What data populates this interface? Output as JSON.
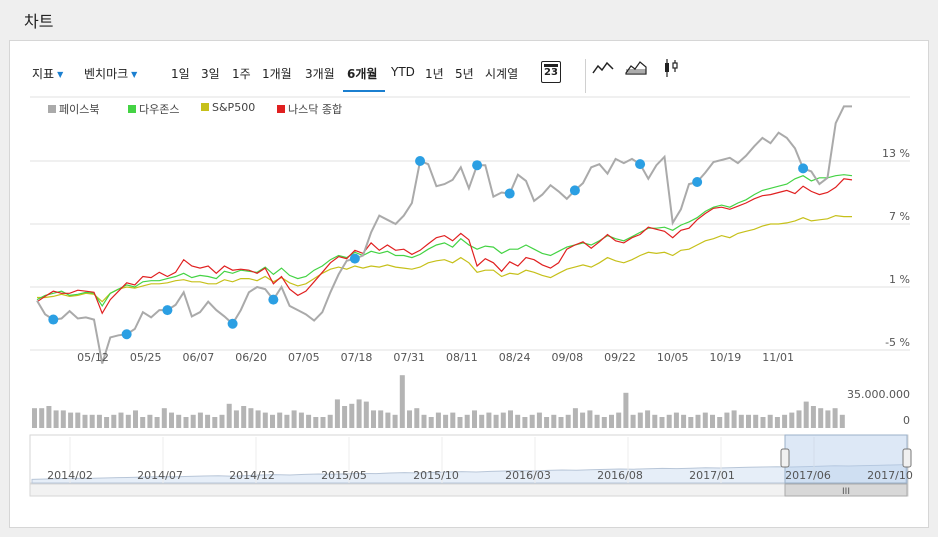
{
  "header": {
    "title": "차트"
  },
  "toolbar": {
    "indicator_label": "지표",
    "benchmark_label": "벤치마크",
    "periods": [
      "1일",
      "3일",
      "1주",
      "1개월",
      "3개월",
      "6개월",
      "YTD",
      "1년",
      "5년",
      "시계열"
    ],
    "active_period": "6개월",
    "calendar_label": "23"
  },
  "legend": [
    {
      "name": "페이스북",
      "color": "#aaaaaa"
    },
    {
      "name": "다우존스",
      "color": "#44d344"
    },
    {
      "name": "S&P500",
      "color": "#c6c01a"
    },
    {
      "name": "나스닥 종합",
      "color": "#e02020"
    }
  ],
  "volume_axis": {
    "max_label": "35.000.000",
    "min_label": "0"
  },
  "navigator": {
    "labels": [
      "2014/02",
      "2014/07",
      "2014/12",
      "2015/05",
      "2015/10",
      "2016/03",
      "2016/08",
      "2017/01",
      "2017/06",
      "2017/10"
    ]
  },
  "chart_data": {
    "type": "line",
    "y_unit": "%",
    "yticks": [
      "13 %",
      "7 %",
      "1 %",
      "-5 %"
    ],
    "xticks": [
      "05/12",
      "05/25",
      "06/07",
      "06/20",
      "07/05",
      "07/18",
      "07/31",
      "08/11",
      "08/24",
      "09/08",
      "09/22",
      "10/05",
      "10/19",
      "11/01"
    ],
    "ylim": [
      -5,
      19
    ],
    "series": [
      {
        "name": "페이스북",
        "color": "#aaaaaa",
        "values": [
          -0.3,
          -1.6,
          -2.1,
          -2.0,
          -1.3,
          -2.0,
          -1.9,
          -2.1,
          -6.3,
          -3.8,
          -3.6,
          -3.5,
          -3.0,
          -1.4,
          -1.9,
          -1.2,
          -1.2,
          -0.7,
          0.5,
          -1.8,
          -1.4,
          -0.4,
          -1.2,
          -1.8,
          -2.5,
          -1.2,
          0.5,
          1.0,
          0.8,
          -0.2,
          1.0,
          -0.8,
          -1.2,
          -1.6,
          -2.2,
          -1.4,
          0.5,
          2.2,
          3.5,
          3.7,
          4.0,
          6.2,
          7.8,
          7.4,
          7.0,
          7.8,
          9.0,
          13.0,
          12.7,
          10.6,
          10.8,
          11.2,
          12.4,
          10.4,
          12.6,
          12.6,
          9.6,
          10.0,
          9.9,
          11.7,
          11.1,
          9.2,
          9.8,
          10.7,
          10.1,
          9.4,
          10.2,
          10.9,
          12.4,
          12.7,
          11.8,
          13.2,
          12.8,
          13.2,
          12.7,
          11.3,
          12.6,
          13.4,
          7.1,
          8.4,
          10.8,
          11.0,
          11.9,
          12.9,
          13.1,
          13.3,
          12.8,
          13.5,
          14.4,
          15.2,
          14.7,
          15.7,
          15.2,
          14.2,
          12.3,
          12.0,
          10.8,
          11.4,
          16.6,
          18.2,
          18.2
        ]
      },
      {
        "name": "다우존스",
        "color": "#44d344",
        "values": [
          -0.2,
          0.2,
          0.4,
          0.6,
          0.2,
          0.3,
          0.5,
          0.4,
          -0.8,
          0.4,
          0.8,
          1.2,
          1.0,
          1.5,
          1.6,
          1.6,
          1.8,
          2.0,
          2.3,
          1.9,
          2.1,
          2.0,
          1.8,
          2.5,
          2.3,
          2.6,
          2.5,
          2.4,
          2.9,
          2.2,
          2.8,
          2.1,
          1.8,
          2.0,
          2.6,
          3.0,
          3.6,
          4.0,
          3.8,
          4.3,
          4.0,
          4.4,
          4.2,
          4.4,
          4.0,
          4.0,
          3.8,
          4.1,
          4.6,
          5.0,
          5.2,
          4.8,
          5.6,
          5.0,
          4.6,
          4.9,
          4.8,
          4.2,
          4.6,
          4.6,
          5.0,
          4.6,
          4.2,
          4.0,
          4.4,
          4.8,
          5.0,
          5.2,
          5.0,
          5.4,
          5.9,
          5.6,
          5.4,
          5.8,
          6.2,
          6.6,
          6.6,
          6.7,
          6.4,
          6.9,
          7.2,
          7.6,
          8.2,
          8.6,
          8.8,
          8.6,
          9.0,
          9.3,
          9.8,
          10.2,
          10.4,
          10.6,
          10.8,
          11.3,
          11.6,
          11.1,
          11.4,
          11.4,
          11.6,
          11.7,
          11.6
        ]
      },
      {
        "name": "S&P500",
        "color": "#c6c01a",
        "values": [
          0,
          0,
          0.1,
          0.3,
          0.1,
          0.2,
          0.4,
          0.3,
          -0.4,
          0.4,
          0.8,
          1.0,
          0.9,
          1.1,
          1.3,
          1.3,
          1.4,
          1.6,
          1.7,
          1.5,
          1.5,
          1.3,
          1.3,
          1.7,
          1.5,
          1.8,
          1.8,
          1.6,
          2.0,
          1.5,
          1.9,
          1.4,
          1.1,
          1.3,
          1.8,
          2.3,
          2.7,
          2.9,
          2.7,
          3.0,
          2.8,
          3.0,
          2.9,
          3.1,
          2.9,
          2.8,
          2.7,
          2.9,
          3.3,
          3.5,
          3.6,
          3.3,
          3.8,
          3.3,
          2.4,
          2.6,
          2.6,
          2.0,
          2.3,
          2.2,
          2.6,
          2.4,
          2.1,
          1.9,
          2.3,
          2.7,
          2.9,
          3.1,
          2.9,
          3.3,
          3.8,
          3.5,
          3.3,
          3.6,
          4.0,
          4.3,
          4.2,
          4.3,
          4.0,
          4.5,
          4.6,
          5.0,
          5.4,
          5.6,
          5.9,
          5.7,
          6.1,
          6.3,
          6.5,
          6.8,
          7.0,
          7.0,
          7.1,
          7.3,
          7.6,
          7.3,
          7.4,
          7.5,
          7.8,
          7.7,
          7.7
        ]
      },
      {
        "name": "나스닥 종합",
        "color": "#e02020",
        "values": [
          -0.4,
          0.1,
          0.6,
          0.4,
          0.4,
          0.7,
          0.6,
          0.5,
          -1.5,
          -0.2,
          0.6,
          1.4,
          1.2,
          2.0,
          1.9,
          2.4,
          2.0,
          2.4,
          3.6,
          3.0,
          2.8,
          3.0,
          2.3,
          3.0,
          2.6,
          2.7,
          2.6,
          2.3,
          2.8,
          1.3,
          2.0,
          0.8,
          0.2,
          0.6,
          1.5,
          2.4,
          3.3,
          3.9,
          3.7,
          4.5,
          4.2,
          5.2,
          4.5,
          5.0,
          4.5,
          4.6,
          4.1,
          4.5,
          5.1,
          5.7,
          5.9,
          5.4,
          6.1,
          5.5,
          3.0,
          3.7,
          3.3,
          2.5,
          3.4,
          3.0,
          3.8,
          3.6,
          3.1,
          2.8,
          3.3,
          4.6,
          5.0,
          5.3,
          4.7,
          5.3,
          6.0,
          5.4,
          5.2,
          5.7,
          6.0,
          6.7,
          6.5,
          6.3,
          5.7,
          6.4,
          6.6,
          7.4,
          8.0,
          8.5,
          8.6,
          8.4,
          8.7,
          9.0,
          9.4,
          9.7,
          9.8,
          10.0,
          10.2,
          9.9,
          10.6,
          10.1,
          9.8,
          10.0,
          10.5,
          11.3,
          11.2
        ]
      }
    ],
    "event_markers": {
      "series": "페이스북",
      "indices": [
        2,
        11,
        16,
        24,
        29,
        39,
        47,
        54,
        58,
        66,
        74,
        81,
        94
      ]
    },
    "volume": {
      "ymax_label": "35.000.000",
      "values": [
        9,
        9,
        10,
        8,
        8,
        7,
        7,
        6,
        6,
        6,
        5,
        6,
        7,
        6,
        8,
        5,
        6,
        5,
        9,
        7,
        6,
        5,
        6,
        7,
        6,
        5,
        6,
        11,
        8,
        10,
        9,
        8,
        7,
        6,
        7,
        6,
        8,
        7,
        6,
        5,
        5,
        6,
        13,
        10,
        11,
        13,
        12,
        8,
        8,
        7,
        6,
        24,
        8,
        9,
        6,
        5,
        7,
        6,
        7,
        5,
        6,
        8,
        6,
        7,
        6,
        7,
        8,
        6,
        5,
        6,
        7,
        5,
        6,
        5,
        6,
        9,
        7,
        8,
        6,
        5,
        6,
        7,
        16,
        6,
        7,
        8,
        6,
        5,
        6,
        7,
        6,
        5,
        6,
        7,
        6,
        5,
        7,
        8,
        6,
        6,
        6,
        5,
        6,
        5,
        6,
        7,
        8,
        12,
        10,
        9,
        8,
        9,
        6
      ]
    },
    "navigator_line": [
      0.18,
      0.2,
      0.22,
      0.24,
      0.23,
      0.25,
      0.27,
      0.28,
      0.3,
      0.32,
      0.31,
      0.33,
      0.35,
      0.36,
      0.34,
      0.37,
      0.4,
      0.42,
      0.4,
      0.43,
      0.45,
      0.44,
      0.46,
      0.48,
      0.47,
      0.5,
      0.52,
      0.5,
      0.53,
      0.55,
      0.57,
      0.55,
      0.58,
      0.6,
      0.62,
      0.6,
      0.63,
      0.65,
      0.64,
      0.66,
      0.68,
      0.7,
      0.69,
      0.71,
      0.73,
      0.72,
      0.74,
      0.76,
      0.75,
      0.77,
      0.79,
      0.8,
      0.81,
      0.8,
      0.82,
      0.84,
      0.86,
      0.85,
      0.87,
      0.88,
      0.9,
      0.92
    ]
  }
}
